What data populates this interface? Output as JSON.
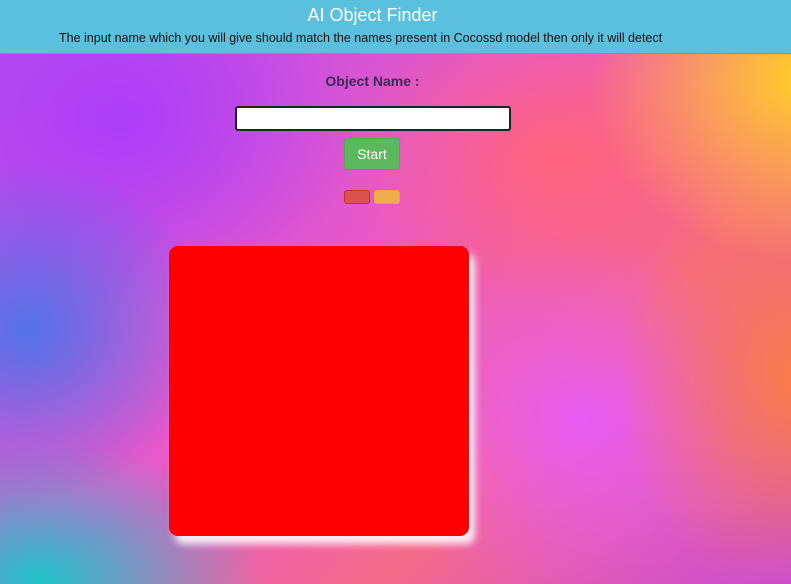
{
  "header": {
    "title": "AI Object Finder",
    "subtitle": "The input name which you will give should match the names present in Cocossd model then only it will detect",
    "background_color": "#5bc0de"
  },
  "form": {
    "object_label": "Object Name :",
    "input_value": "",
    "start_label": "Start",
    "start_color": "#5cb85c"
  },
  "indicators": [
    {
      "name": "red-indicator-button",
      "color": "#d9534f"
    },
    {
      "name": "orange-indicator-button",
      "color": "#f0ad4e"
    }
  ],
  "video": {
    "display_color": "#ff0000"
  }
}
